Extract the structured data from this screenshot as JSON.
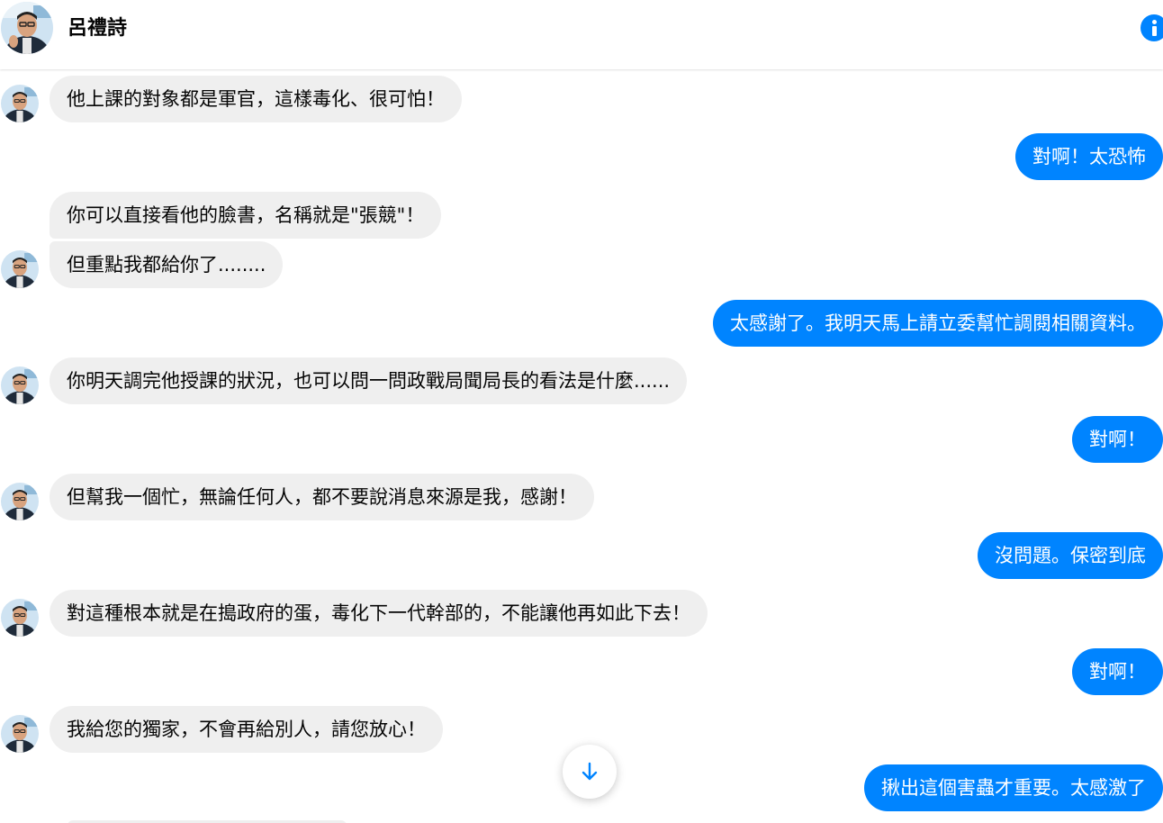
{
  "header": {
    "name": "呂禮詩",
    "info_icon": "info-icon"
  },
  "messages": [
    {
      "dir": "in",
      "text": "他上課的對象都是軍官，這樣毒化、很可怕！"
    },
    {
      "dir": "out",
      "text": "對啊！太恐怖"
    },
    {
      "dir": "in",
      "text": "你可以直接看他的臉書，名稱就是\"張競\"！"
    },
    {
      "dir": "in",
      "text": "但重點我都給你了........"
    },
    {
      "dir": "out",
      "text": "太感謝了。我明天馬上請立委幫忙調閱相關資料。"
    },
    {
      "dir": "in",
      "text": "你明天調完他授課的狀況，也可以問一問政戰局聞局長的看法是什麼......"
    },
    {
      "dir": "out",
      "text": "對啊！"
    },
    {
      "dir": "in",
      "text": "但幫我一個忙，無論任何人，都不要說消息來源是我，感謝！"
    },
    {
      "dir": "out",
      "text": "沒問題。保密到底"
    },
    {
      "dir": "in",
      "text": "對這種根本就是在搗政府的蛋，毒化下一代幹部的，不能讓他再如此下去！"
    },
    {
      "dir": "out",
      "text": "對啊！"
    },
    {
      "dir": "in",
      "text": "我給您的獨家，不會再給別人，請您放心！"
    },
    {
      "dir": "out",
      "text": "揪出這個害蟲才重要。太感激了"
    }
  ],
  "scroll_button": {
    "icon": "arrow-down-icon"
  },
  "colors": {
    "accent": "#0084ff",
    "incoming_bubble": "#efefef",
    "text": "#050505"
  }
}
